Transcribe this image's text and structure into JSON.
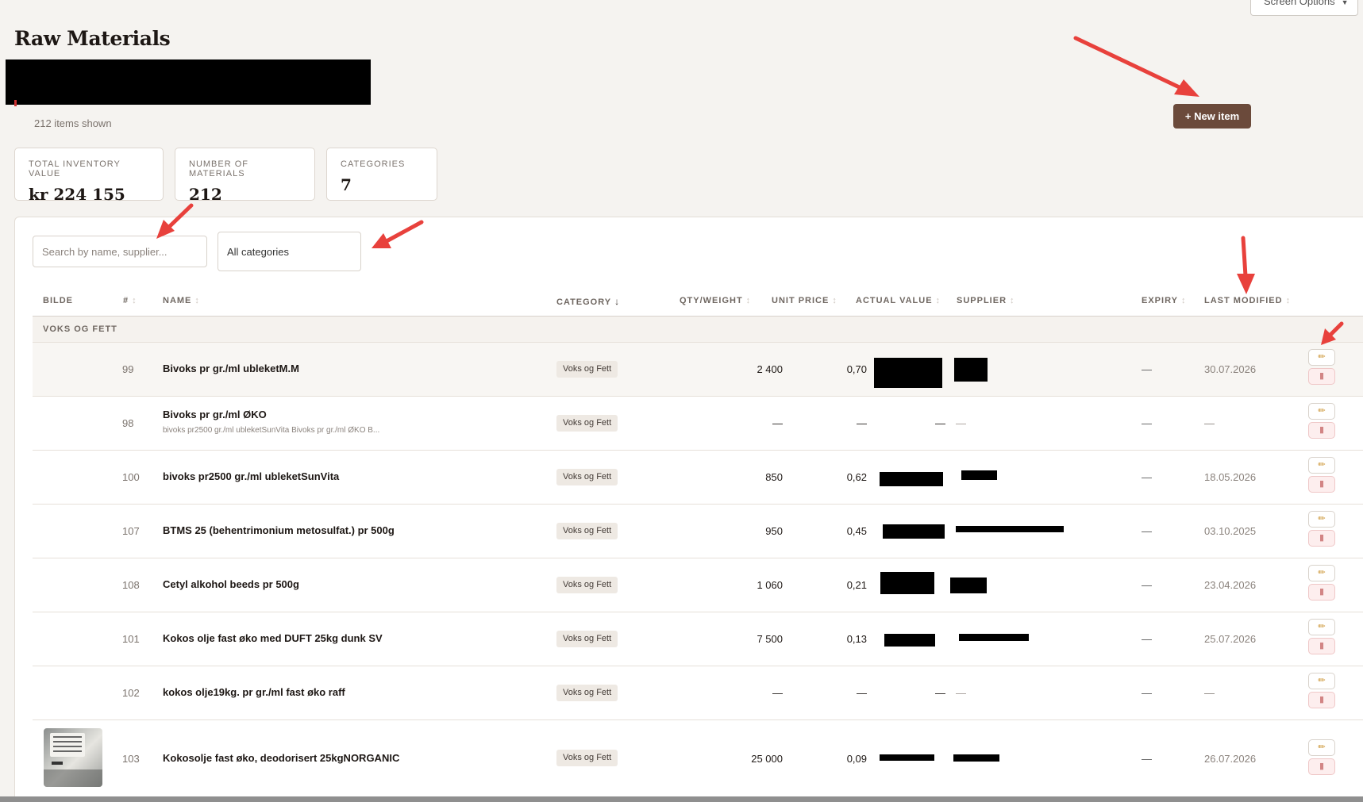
{
  "header": {
    "screen_options": "Screen Options",
    "title": "Raw Materials",
    "items_shown": "212 items shown",
    "new_item_label": "+ New item"
  },
  "stats": [
    {
      "label": "TOTAL INVENTORY VALUE",
      "value": "kr 224 155"
    },
    {
      "label": "NUMBER OF MATERIALS",
      "value": "212"
    },
    {
      "label": "CATEGORIES",
      "value": "7"
    }
  ],
  "filters": {
    "search_placeholder": "Search by name, supplier...",
    "category_selected": "All categories"
  },
  "columns": {
    "image": "BILDE",
    "number": "#",
    "name": "NAME",
    "category": "CATEGORY",
    "qty": "QTY/WEIGHT",
    "unit_price": "UNIT PRICE",
    "actual_value": "ACTUAL VALUE",
    "supplier": "SUPPLIER",
    "expiry": "EXPIRY",
    "last_modified": "LAST MODIFIED"
  },
  "sort_icons": {
    "inactive": "↕",
    "active": "↓"
  },
  "icons": {
    "edit": "pencil-icon",
    "delete": "trash-icon",
    "edit_glyph": "✏",
    "delete_glyph": "▮"
  },
  "group": {
    "label": "VOKS OG FETT"
  },
  "rows": [
    {
      "num": "99",
      "name": "Bivoks pr gr./ml ubleketM.M",
      "sub": "",
      "category": "Voks og Fett",
      "qty": "2 400",
      "unit_price": "0,70",
      "actual_value": "",
      "supplier": "",
      "expiry": "—",
      "last_modified": "30.07.2026"
    },
    {
      "num": "98",
      "name": "Bivoks pr gr./ml ØKO",
      "sub": "bivoks pr2500 gr./ml ubleketSunVita Bivoks pr gr./ml ØKO B...",
      "category": "Voks og Fett",
      "qty": "—",
      "unit_price": "—",
      "actual_value": "—",
      "supplier": "—",
      "expiry": "—",
      "last_modified": "—"
    },
    {
      "num": "100",
      "name": "bivoks pr2500 gr./ml ubleketSunVita",
      "sub": "",
      "category": "Voks og Fett",
      "qty": "850",
      "unit_price": "0,62",
      "actual_value": "",
      "supplier": "",
      "expiry": "—",
      "last_modified": "18.05.2026"
    },
    {
      "num": "107",
      "name": "BTMS 25 (behentrimonium metosulfat.) pr 500g",
      "sub": "",
      "category": "Voks og Fett",
      "qty": "950",
      "unit_price": "0,45",
      "actual_value": "",
      "supplier": "",
      "expiry": "—",
      "last_modified": "03.10.2025"
    },
    {
      "num": "108",
      "name": "Cetyl alkohol beeds pr 500g",
      "sub": "",
      "category": "Voks og Fett",
      "qty": "1 060",
      "unit_price": "0,21",
      "actual_value": "",
      "supplier": "",
      "expiry": "—",
      "last_modified": "23.04.2026"
    },
    {
      "num": "101",
      "name": "Kokos olje fast øko med DUFT 25kg dunk SV",
      "sub": "",
      "category": "Voks og Fett",
      "qty": "7 500",
      "unit_price": "0,13",
      "actual_value": "",
      "supplier": "",
      "expiry": "—",
      "last_modified": "25.07.2026"
    },
    {
      "num": "102",
      "name": "kokos olje19kg. pr gr./ml fast øko raff",
      "sub": "",
      "category": "Voks og Fett",
      "qty": "—",
      "unit_price": "—",
      "actual_value": "—",
      "supplier": "—",
      "expiry": "—",
      "last_modified": "—"
    },
    {
      "num": "103",
      "name": "Kokosolje fast øko, deodorisert 25kgNORGANIC",
      "sub": "",
      "category": "Voks og Fett",
      "qty": "25 000",
      "unit_price": "0,09",
      "actual_value": "",
      "supplier": "",
      "expiry": "—",
      "last_modified": "26.07.2026"
    }
  ],
  "colors": {
    "accent": "#6b4a3b",
    "annotation_arrow": "#e8413c",
    "page_bg": "#f5f3f0",
    "category_chip": "#eee9e3"
  }
}
